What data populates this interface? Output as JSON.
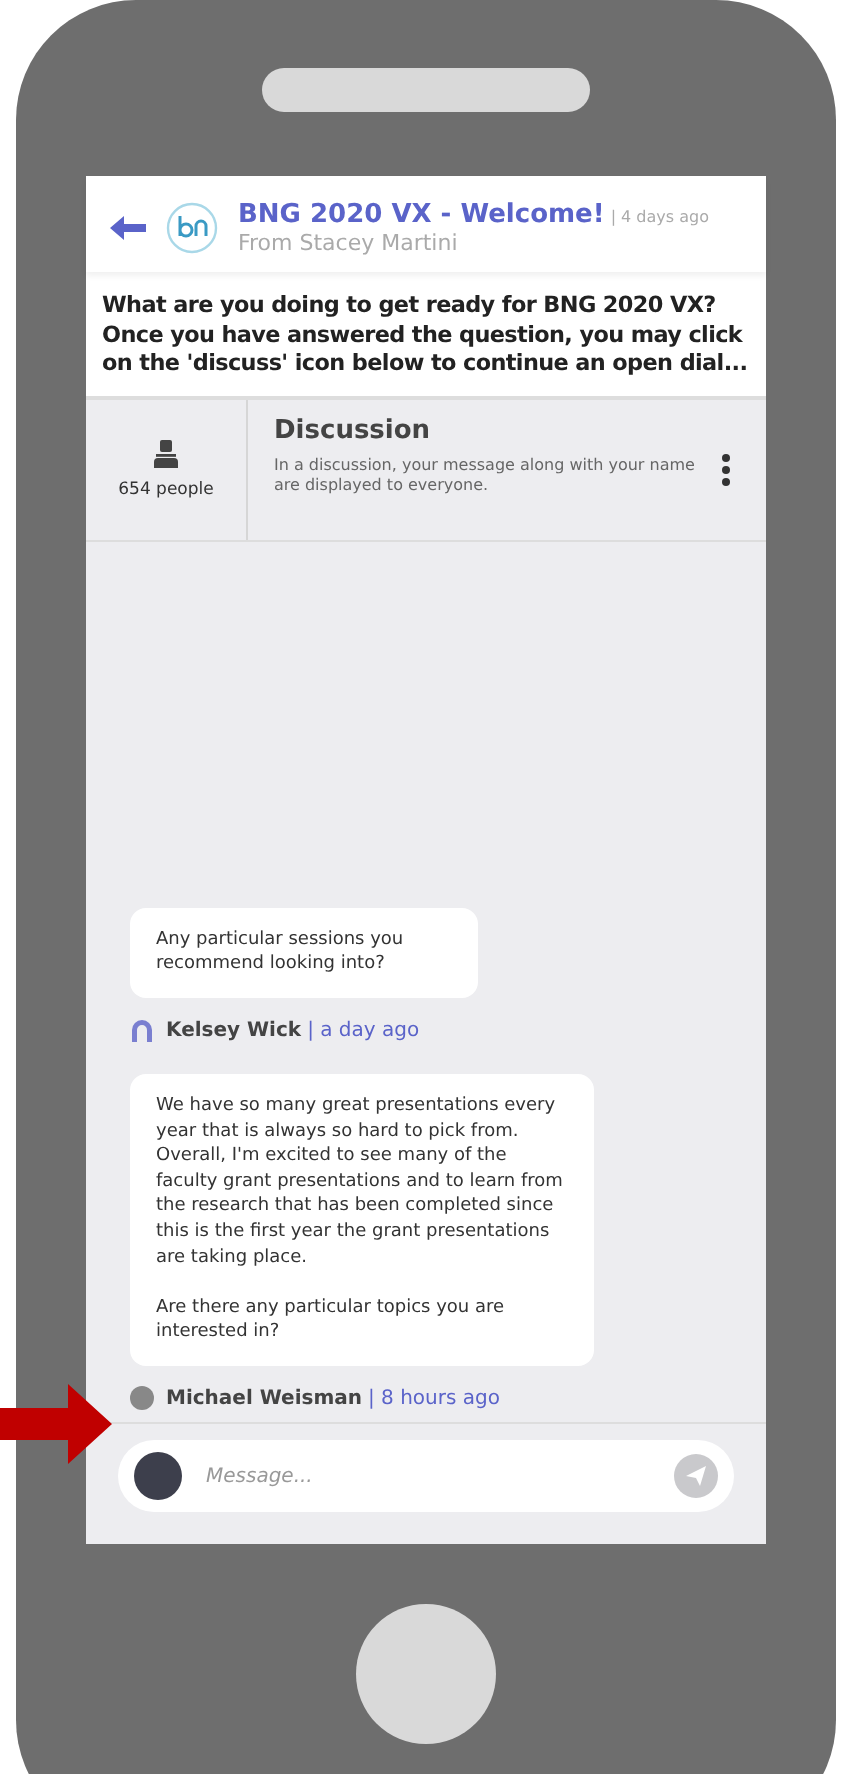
{
  "header": {
    "title": "BNG 2020 VX - Welcome!",
    "time": "| 4 days ago",
    "from": "From Stacey Martini"
  },
  "question": "What are you doing to get ready for BNG 2020 VX? Once you have answered the question, you may click on the 'discuss' icon below to continue an open dial...",
  "discussion": {
    "people": "654 people",
    "title": "Discussion",
    "description": "In a discussion, your message along with your name are displayed to everyone."
  },
  "messages": [
    {
      "text": "Any particular sessions you recommend looking into?",
      "author": "Kelsey Wick",
      "time": "| a day ago",
      "kind": "outline"
    },
    {
      "text": "We have so many great presentations every year that is always so hard to pick from. Overall, I'm excited to see many of the faculty grant presentations and to learn from the research that has been completed since this is the first year the grant presentations are taking place.\n\nAre there any particular topics you are interested in?",
      "author": "Michael Weisman",
      "time": "| 8 hours ago",
      "kind": "photo"
    }
  ],
  "composer": {
    "placeholder": "Message..."
  }
}
